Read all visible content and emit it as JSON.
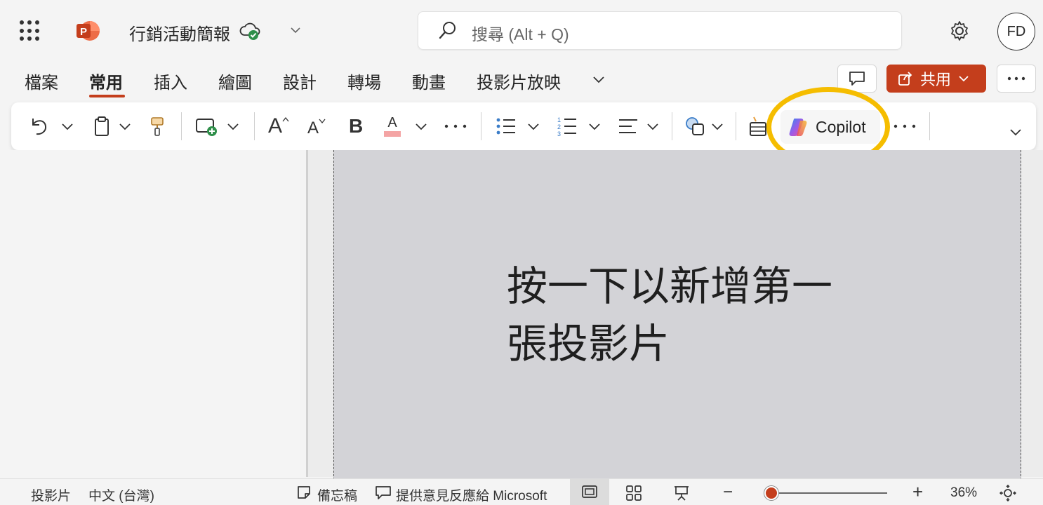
{
  "app": {
    "doc_title": "行銷活動簡報",
    "search_placeholder": "搜尋 (Alt + Q)",
    "avatar_initials": "FD",
    "brand_color": "#c43e1c",
    "highlight_color": "#f5bd00"
  },
  "tabs": [
    {
      "label": "檔案"
    },
    {
      "label": "常用",
      "active": true
    },
    {
      "label": "插入"
    },
    {
      "label": "繪圖"
    },
    {
      "label": "設計"
    },
    {
      "label": "轉場"
    },
    {
      "label": "動畫"
    },
    {
      "label": "投影片放映"
    }
  ],
  "header_actions": {
    "share_label": "共用"
  },
  "ribbon": {
    "copilot_label": "Copilot",
    "font_bold_glyph": "B",
    "font_grow_glyph": "A",
    "font_shrink_glyph": "A",
    "font_color_glyph": "A"
  },
  "slide": {
    "placeholder_line1": "按一下以新增第一",
    "placeholder_line2": "張投影片"
  },
  "status": {
    "slide_label": "投影片",
    "language": "中文 (台灣)",
    "notes_label": "備忘稿",
    "feedback_label": "提供意見反應給 Microsoft",
    "zoom_minus": "−",
    "zoom_plus": "+",
    "zoom_level": "36%"
  },
  "icons": [
    "app-launcher-icon",
    "powerpoint-logo-icon",
    "cloud-saved-icon",
    "chevron-down-icon",
    "search-icon",
    "gear-icon",
    "comment-icon",
    "share-icon",
    "more-icon",
    "undo-icon",
    "clipboard-icon",
    "format-painter-icon",
    "new-slide-icon",
    "bullets-icon",
    "numbering-icon",
    "align-icon",
    "shapes-icon",
    "designer-icon",
    "copilot-icon",
    "notes-icon",
    "feedback-icon",
    "normal-view-icon",
    "slide-sorter-icon",
    "presenter-icon",
    "fit-to-window-icon"
  ]
}
